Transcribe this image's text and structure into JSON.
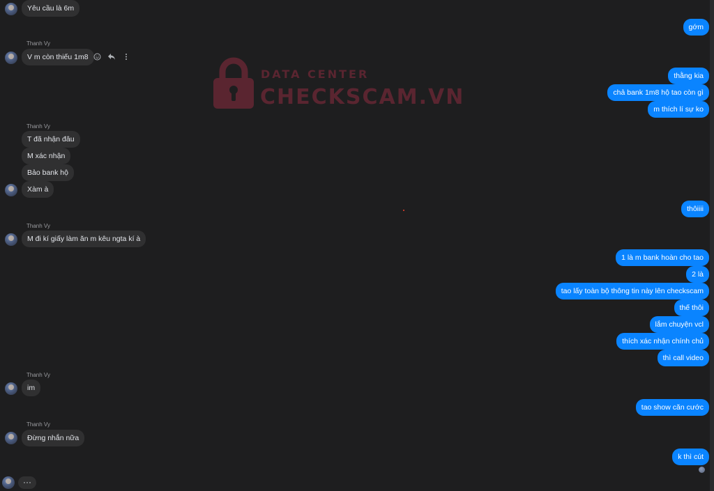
{
  "colors": {
    "background": "#1e1e1f",
    "incoming_bubble": "#303031",
    "outgoing_bubble": "#0a84ff",
    "watermark": "#5a2530"
  },
  "watermark": {
    "line1": "DATA CENTER",
    "line2": "CHECKSCAM.VN",
    "icon": "padlock-icon"
  },
  "messages": {
    "in_yeu_cau": "Yêu cầu là 6m",
    "out_gom": "gớm",
    "sender_1": "Thanh Vy",
    "in_v_m_con_thieu": "V m còn thiếu 1m8",
    "out_thang_kia": "thằng kia",
    "out_cha_bank": "chả bank 1m8 hộ tao còn gì",
    "out_m_thich": "m thích lí sự ko",
    "sender_2": "Thanh Vy",
    "in_t_da_nhan": "T đã nhận đâu",
    "in_m_xac_nhan": "M xác nhận",
    "in_bao_bank": "Bảo bank hộ",
    "in_xam": "Xàm à",
    "out_thoiiii": "thôiiii",
    "sender_3": "Thanh Vy",
    "in_m_di_ki": "M đi kí giấy làm ăn m kêu ngta kí à",
    "out_1_la": "1 là m bank hoàn cho tao",
    "out_2_la": "2 là",
    "out_tao_lay": "tao lấy toàn bộ thông tin này lên checkscam",
    "out_the_thoi": "thế thôi",
    "out_lam_chuyen": "lắm chuyện vcl",
    "out_thich_xac": "thích xác nhận chính chủ",
    "out_thi_call": "thì call video",
    "sender_4": "Thanh Vy",
    "in_im": "im",
    "out_tao_show": "tao show căn cước",
    "sender_5": "Thanh Vy",
    "in_dung_nhan": "Đừng nhắn nữa",
    "out_k_thi_cut": "k thì cút"
  },
  "message_actions": {
    "react_icon": "smiley-icon",
    "reply_icon": "reply-icon",
    "more_icon": "more-dots-icon"
  },
  "typing_indicator": "typing-dots"
}
